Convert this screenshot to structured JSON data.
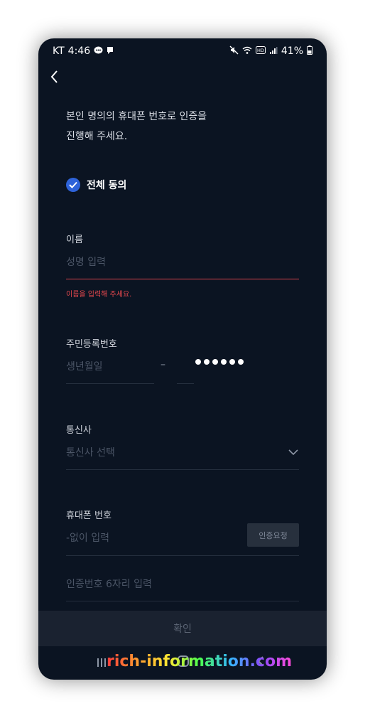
{
  "status_bar": {
    "carrier": "KT",
    "time": "4:46",
    "battery": "41%",
    "icons": [
      "chat-bubble-icon",
      "message-icon",
      "mute-icon",
      "wifi-icon",
      "hd-icon",
      "signal-icon",
      "battery-icon"
    ]
  },
  "header": {
    "back_icon": "chevron-left-icon"
  },
  "intro": {
    "line1": "본인 명의의 휴대폰 번호로 인증을",
    "line2": "진행해 주세요."
  },
  "agree_all": {
    "label": "전체 동의",
    "checked": true,
    "color": "#2e63d9"
  },
  "name": {
    "label": "이름",
    "placeholder": "성명 입력",
    "value": "",
    "error": "이름을 입력해 주세요.",
    "error_color": "#e5484d"
  },
  "resident_number": {
    "label": "주민등록번호",
    "birth_placeholder": "생년월일",
    "separator": "–",
    "masked_digits": 6
  },
  "carrier": {
    "label": "통신사",
    "placeholder": "통신사 선택"
  },
  "phone": {
    "label": "휴대폰 번호",
    "placeholder": "-없이 입력",
    "request_button": "인증요청"
  },
  "verification": {
    "placeholder": "인증번호 6자리 입력"
  },
  "confirm_button": "확인",
  "watermark": "rich-information.com",
  "colors": {
    "background": "#0b1422",
    "accent": "#2e63d9",
    "error": "#e5484d",
    "button_bg": "#1a2230"
  }
}
